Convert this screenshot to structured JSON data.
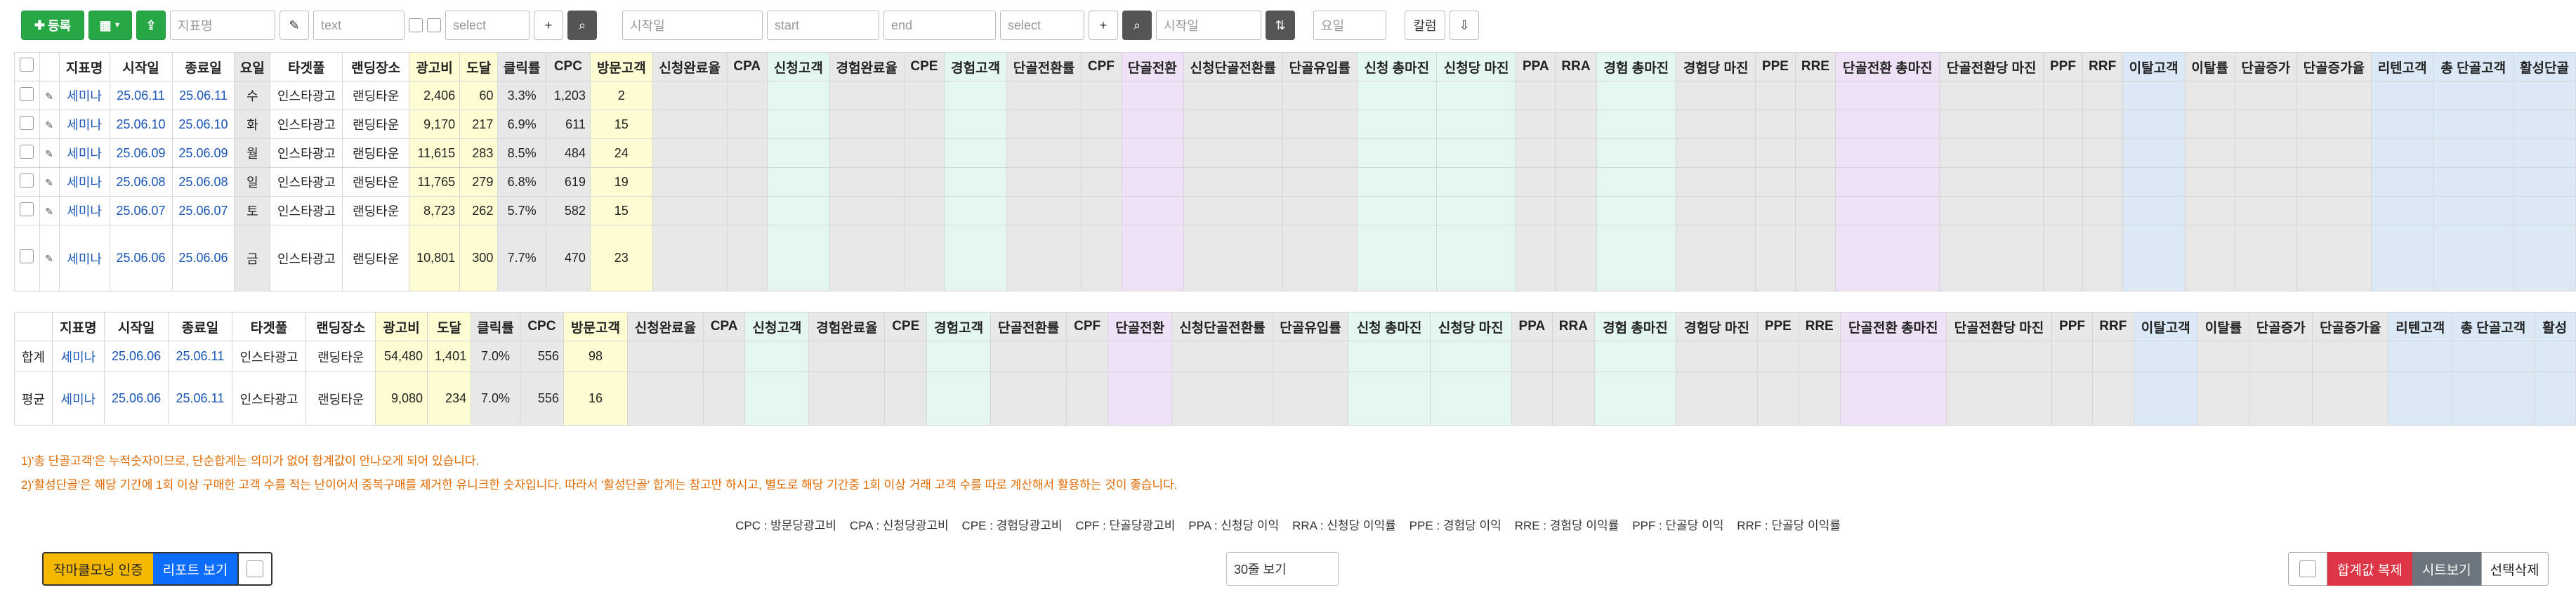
{
  "toolbar": {
    "register_label": "등록",
    "field_placeholder": "지표명",
    "text_placeholder": "text",
    "select_placeholder": "select",
    "date_field_placeholder": "시작일",
    "start_placeholder": "start",
    "end_placeholder": "end",
    "select2_placeholder": "select",
    "date2_placeholder": "시작일",
    "weekday_placeholder": "요일",
    "column_label": "칼럼"
  },
  "headers": [
    "지표명",
    "시작일",
    "종료일",
    "요일",
    "타겟풀",
    "랜딩장소",
    "광고비",
    "도달",
    "클릭률",
    "CPC",
    "방문고객",
    "신청완료율",
    "CPA",
    "신청고객",
    "경험완료율",
    "CPE",
    "경험고객",
    "단골전환률",
    "CPF",
    "단골전환",
    "신청단골전환률",
    "단골유입률",
    "신청 총마진",
    "신청당 마진",
    "PPA",
    "RRA",
    "경험 총마진",
    "경험당 마진",
    "PPE",
    "RRE",
    "단골전환 총마진",
    "단골전환당 마진",
    "PPF",
    "RRF",
    "이탈고객",
    "이탈률",
    "단골증가",
    "단골증가율",
    "리텐고객",
    "총 단골고객",
    "활성단골"
  ],
  "rows": [
    {
      "name": "세미나",
      "start": "25.06.11",
      "end": "25.06.11",
      "day": "수",
      "target": "인스타광고",
      "landing": "랜딩타운",
      "cost": "2,406",
      "reach": "60",
      "ctr": "3.3%",
      "cpc": "1,203",
      "visit": "2"
    },
    {
      "name": "세미나",
      "start": "25.06.10",
      "end": "25.06.10",
      "day": "화",
      "target": "인스타광고",
      "landing": "랜딩타운",
      "cost": "9,170",
      "reach": "217",
      "ctr": "6.9%",
      "cpc": "611",
      "visit": "15"
    },
    {
      "name": "세미나",
      "start": "25.06.09",
      "end": "25.06.09",
      "day": "월",
      "target": "인스타광고",
      "landing": "랜딩타운",
      "cost": "11,615",
      "reach": "283",
      "ctr": "8.5%",
      "cpc": "484",
      "visit": "24"
    },
    {
      "name": "세미나",
      "start": "25.06.08",
      "end": "25.06.08",
      "day": "일",
      "target": "인스타광고",
      "landing": "랜딩타운",
      "cost": "11,765",
      "reach": "279",
      "ctr": "6.8%",
      "cpc": "619",
      "visit": "19"
    },
    {
      "name": "세미나",
      "start": "25.06.07",
      "end": "25.06.07",
      "day": "토",
      "target": "인스타광고",
      "landing": "랜딩타운",
      "cost": "8,723",
      "reach": "262",
      "ctr": "5.7%",
      "cpc": "582",
      "visit": "15"
    },
    {
      "name": "세미나",
      "start": "25.06.06",
      "end": "25.06.06",
      "day": "금",
      "target": "인스타광고",
      "landing": "랜딩타운",
      "cost": "10,801",
      "reach": "300",
      "ctr": "7.7%",
      "cpc": "470",
      "visit": "23"
    }
  ],
  "summary_headers": [
    "지표명",
    "시작일",
    "종료일",
    "타겟풀",
    "랜딩장소",
    "광고비",
    "도달",
    "클릭률",
    "CPC",
    "방문고객",
    "신청완료율",
    "CPA",
    "신청고객",
    "경험완료율",
    "CPE",
    "경험고객",
    "단골전환률",
    "CPF",
    "단골전환",
    "신청단골전환률",
    "단골유입률",
    "신청 총마진",
    "신청당 마진",
    "PPA",
    "RRA",
    "경험 총마진",
    "경험당 마진",
    "PPE",
    "RRE",
    "단골전환 총마진",
    "단골전환당 마진",
    "PPF",
    "RRF",
    "이탈고객",
    "이탈률",
    "단골증가",
    "단골증가율",
    "리텐고객",
    "총 단골고객",
    "활성"
  ],
  "summary_rows": [
    {
      "label": "합계",
      "name": "세미나",
      "start": "25.06.06",
      "end": "25.06.11",
      "target": "인스타광고",
      "landing": "랜딩타운",
      "cost": "54,480",
      "reach": "1,401",
      "ctr": "7.0%",
      "cpc": "556",
      "visit": "98"
    },
    {
      "label": "평균",
      "name": "세미나",
      "start": "25.06.06",
      "end": "25.06.11",
      "target": "인스타광고",
      "landing": "랜딩타운",
      "cost": "9,080",
      "reach": "234",
      "ctr": "7.0%",
      "cpc": "556",
      "visit": "16"
    }
  ],
  "notes": [
    "1)'총 단골고객'은 누적숫자이므로, 단순합계는 의미가 없어 합계값이 안나오게 되어 있습니다.",
    "2)'활성단골'은 해당 기간에 1회 이상 구매한 고객 수를 적는 난이어서 중복구매를 제거한 유니크한 숫자입니다. 따라서 '활성단골' 합계는 참고만 하시고, 별도로 해당 기간중 1회 이상 거래 고객 수를 따로 계산해서 활용하는 것이 좋습니다."
  ],
  "abbreviations": "CPC : 방문당광고비    CPA : 신청당광고비    CPE : 경험당광고비    CPF : 단골당광고비    PPA : 신청당 이익    RRA : 신청당 이익률    PPE : 경험당 이익    RRE : 경험당 이익률    PPF : 단골당 이익    RRF : 단골당 이익률",
  "footer": {
    "morning_label": "작마클모닝 인증",
    "report_label": "리포트 보기",
    "rows_select": "30줄 보기",
    "copy_label": "합계값 복제",
    "sheet_label": "시트보기",
    "delete_label": "선택삭제"
  },
  "colors": {
    "green": "#28a745",
    "yellow": "#f5b800",
    "blue": "#0d6efd",
    "red": "#dc3545",
    "gray": "#6c757d",
    "note": "#e06a00"
  }
}
